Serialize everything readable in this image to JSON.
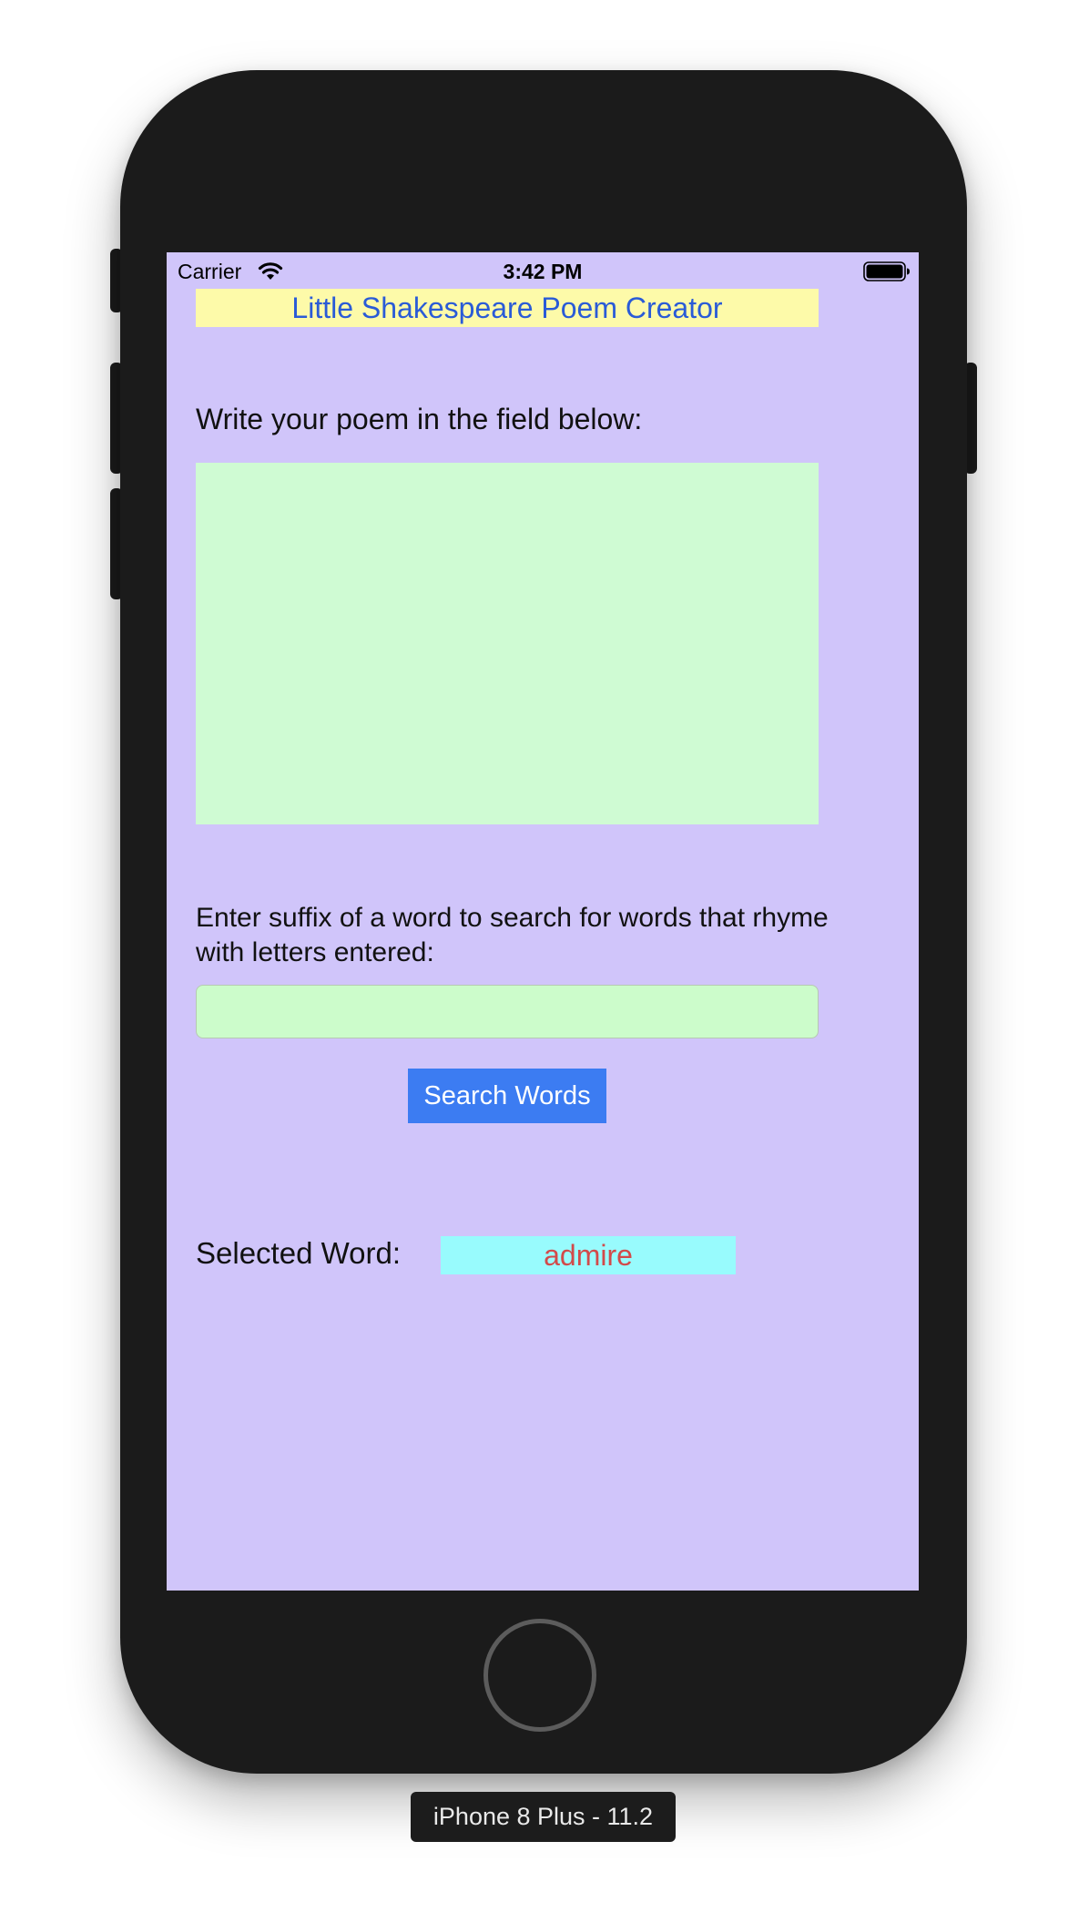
{
  "status_bar": {
    "carrier": "Carrier",
    "time": "3:42 PM",
    "wifi_icon": "wifi-icon",
    "battery_icon": "battery-full-icon"
  },
  "app": {
    "title": "Little Shakespeare Poem Creator",
    "poem_prompt": "Write your poem in the field below:",
    "poem_value": "",
    "suffix_prompt": "Enter suffix of a word to search for words that rhyme with letters entered:",
    "suffix_value": "",
    "search_button": "Search Words",
    "selected_label": "Selected Word:",
    "selected_word": "admire"
  },
  "device": {
    "label": "iPhone 8 Plus - 11.2"
  },
  "colors": {
    "screen_background": "#d0c5fa",
    "title_background": "#fdfaa9",
    "title_text": "#2a5bd7",
    "poem_field": "#cffbd3",
    "suffix_field": "#ccfccb",
    "button_background": "#3c7cf2",
    "selected_background": "#98fbfd",
    "selected_text": "#d24a4a"
  }
}
